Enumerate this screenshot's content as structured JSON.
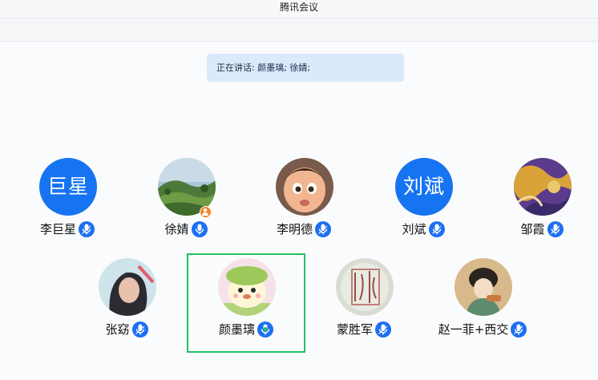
{
  "window": {
    "title": "腾讯会议"
  },
  "speaking": {
    "text": "正在讲话: 颜墨璃; 徐婧;"
  },
  "participants": [
    {
      "name": "李巨星",
      "avatar_text": "巨星",
      "avatar": "text",
      "mic": "on"
    },
    {
      "name": "徐婧",
      "avatar": "photo-green-hills",
      "mic": "on",
      "badge": "host-icon"
    },
    {
      "name": "李明德",
      "avatar": "photo-cartoon-girl",
      "mic": "on"
    },
    {
      "name": "刘斌",
      "avatar_text": "刘斌",
      "avatar": "text",
      "mic": "on"
    },
    {
      "name": "邹霞",
      "avatar": "photo-abstract-art",
      "mic": "on"
    },
    {
      "name": "张窈",
      "avatar": "photo-portrait",
      "mic": "on"
    },
    {
      "name": "颜墨璃",
      "avatar": "photo-cartoon-cat",
      "mic": "speaking",
      "selected": true
    },
    {
      "name": "蒙胜军",
      "avatar": "photo-calligraphy",
      "mic": "on"
    },
    {
      "name": "赵一菲+西交",
      "avatar": "photo-painting",
      "mic": "on"
    }
  ],
  "colors": {
    "accent": "#1674f2",
    "mic": "#1c6ff0",
    "speaking": "#20c063",
    "banner": "#dbe9fb",
    "host_badge": "#f5842a"
  }
}
